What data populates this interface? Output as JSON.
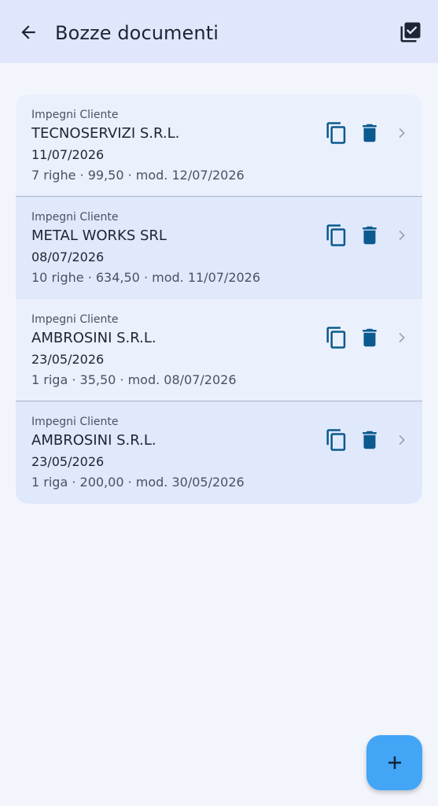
{
  "app_bar": {
    "title": "Bozze documenti",
    "back_icon": "arrow-back-icon",
    "select_icon": "checklist-select-icon"
  },
  "drafts": [
    {
      "type": "Impegni Cliente",
      "customer": "TECNOSERVIZI S.R.L.",
      "date": "11/07/2026",
      "summary": "7 righe · 99,50 · mod. 12/07/2026"
    },
    {
      "type": "Impegni Cliente",
      "customer": "METAL WORKS SRL",
      "date": "08/07/2026",
      "summary": "10 righe · 634,50 · mod. 11/07/2026"
    },
    {
      "type": "Impegni Cliente",
      "customer": "AMBROSINI S.R.L.",
      "date": "23/05/2026",
      "summary": "1 riga · 35,50 · mod. 08/07/2026"
    },
    {
      "type": "Impegni Cliente",
      "customer": "AMBROSINI S.R.L.",
      "date": "23/05/2026",
      "summary": "1 riga · 200,00 · mod. 30/05/2026"
    }
  ],
  "row_actions": {
    "copy_icon": "copy-icon",
    "delete_icon": "delete-icon",
    "open_icon": "chevron-right-icon"
  },
  "fab": {
    "icon": "plus-icon"
  },
  "colors": {
    "background": "#f3f5fd",
    "app_bar": "#e0e7fd",
    "accent": "#0b5a8f",
    "fab": "#42a5f5",
    "row_alt": "#e0e8fb"
  }
}
